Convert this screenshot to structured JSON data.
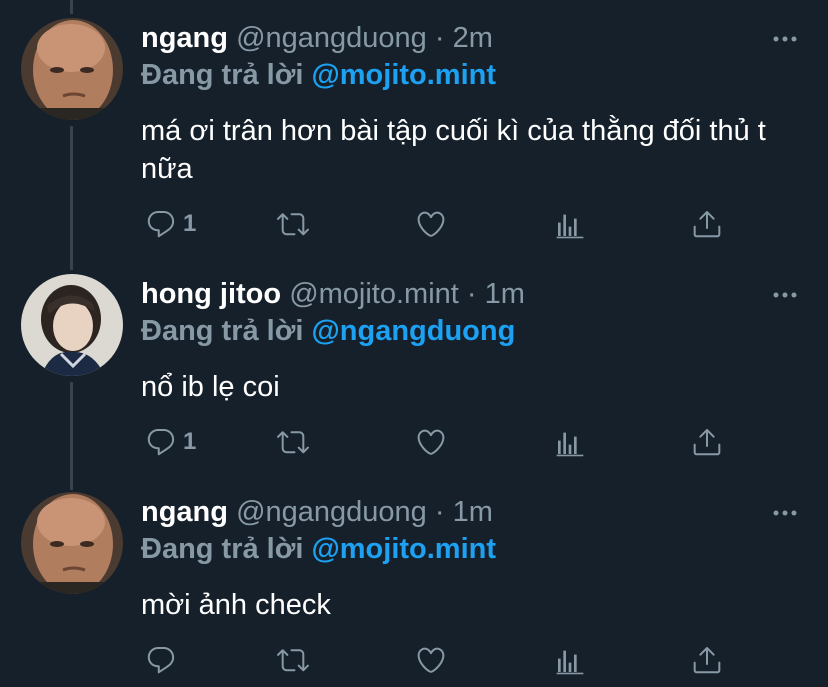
{
  "replying_prefix": "Đang trả lời",
  "tweets": [
    {
      "name": "ngang",
      "handle": "@ngangduong",
      "time": "2m",
      "replying_to": "@mojito.mint",
      "text": "má ơi trân hơn bài tập cuối kì của thằng đối thủ t nữa",
      "reply_count": "1",
      "avatar": "bald-man-avatar"
    },
    {
      "name": "hong jitoo",
      "handle": "@mojito.mint",
      "time": "1m",
      "replying_to": "@ngangduong",
      "text": "nổ ib lẹ coi",
      "reply_count": "1",
      "avatar": "young-person-avatar"
    },
    {
      "name": "ngang",
      "handle": "@ngangduong",
      "time": "1m",
      "replying_to": "@mojito.mint",
      "text": "mời ảnh check",
      "reply_count": "",
      "avatar": "bald-man-avatar"
    }
  ],
  "separator": "·",
  "colors": {
    "background": "#15202b",
    "muted": "#8899a6",
    "accent": "#1da1f2",
    "thread_line": "#38444d"
  }
}
